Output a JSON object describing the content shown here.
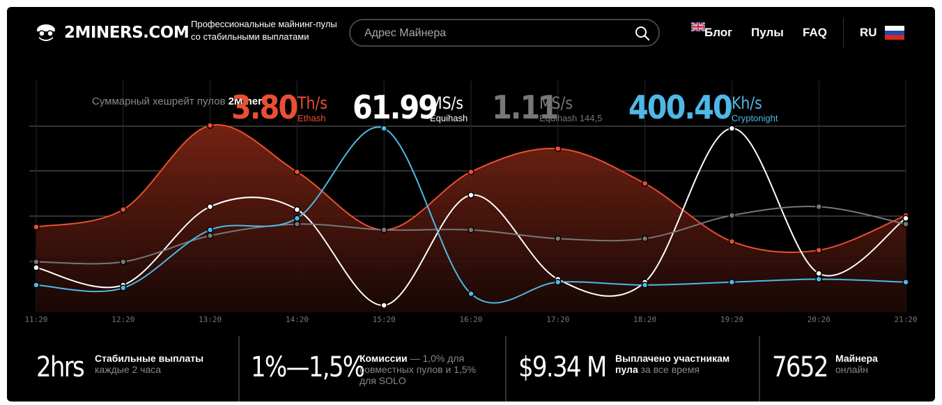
{
  "header": {
    "logo_text": "2MINERS.COM",
    "tagline": "Профессиональные майнинг-пулы со стабильными выплатами",
    "search_placeholder": "Адрес Майнера",
    "nav": {
      "blog": "Блог",
      "pools": "Пулы",
      "faq": "FAQ",
      "lang": "RU"
    }
  },
  "hero": {
    "label_pre": "Суммарный хешрейт пулов",
    "label_brand": "2Miners",
    "items": [
      {
        "value": "3.80",
        "unit": "Th/s",
        "algo": "Ethash",
        "color": "#ea4f33"
      },
      {
        "value": "61.99",
        "unit": "MS/s",
        "algo": "Equihash",
        "color": "#ffffff"
      },
      {
        "value": "1.11",
        "unit": "MS/s",
        "algo": "Equihash 144,5",
        "color": "#777777"
      },
      {
        "value": "400.40",
        "unit": "Kh/s",
        "algo": "Cryptonight",
        "color": "#4fb8e6"
      }
    ]
  },
  "chart_data": {
    "type": "line",
    "x": [
      "11:20",
      "12:20",
      "13:20",
      "14:20",
      "15:20",
      "16:20",
      "17:20",
      "18:20",
      "19:20",
      "20:20",
      "21:20"
    ],
    "series": [
      {
        "name": "Ethash",
        "color": "#ea4f33",
        "values": [
          0.27,
          0.33,
          0.62,
          0.46,
          0.26,
          0.46,
          0.54,
          0.42,
          0.22,
          0.19,
          0.31
        ]
      },
      {
        "name": "Equihash",
        "color": "#ffffff",
        "values": [
          0.13,
          0.07,
          0.34,
          0.33,
          0.0,
          0.38,
          0.09,
          0.08,
          0.61,
          0.11,
          0.3
        ]
      },
      {
        "name": "Equihash 144,5",
        "color": "#777777",
        "values": [
          0.15,
          0.15,
          0.24,
          0.28,
          0.26,
          0.26,
          0.23,
          0.23,
          0.31,
          0.34,
          0.28
        ]
      },
      {
        "name": "Cryptonight",
        "color": "#4fb8e6",
        "values": [
          0.07,
          0.06,
          0.26,
          0.3,
          0.61,
          0.04,
          0.08,
          0.07,
          0.08,
          0.09,
          0.08
        ]
      }
    ]
  },
  "stats": [
    {
      "big": "2hrs",
      "title": "Стабильные выплаты",
      "rest": "каждые 2 часа"
    },
    {
      "big": "1%—1,5%",
      "title": "Комиссии",
      "rest": "— 1,0% для совместных пулов и 1,5% для SOLO"
    },
    {
      "big": "$9.34 M",
      "title": "Выплачено участникам пула",
      "rest": "за все время"
    },
    {
      "big": "7652",
      "title": "Майнера",
      "rest": "онлайн"
    }
  ]
}
